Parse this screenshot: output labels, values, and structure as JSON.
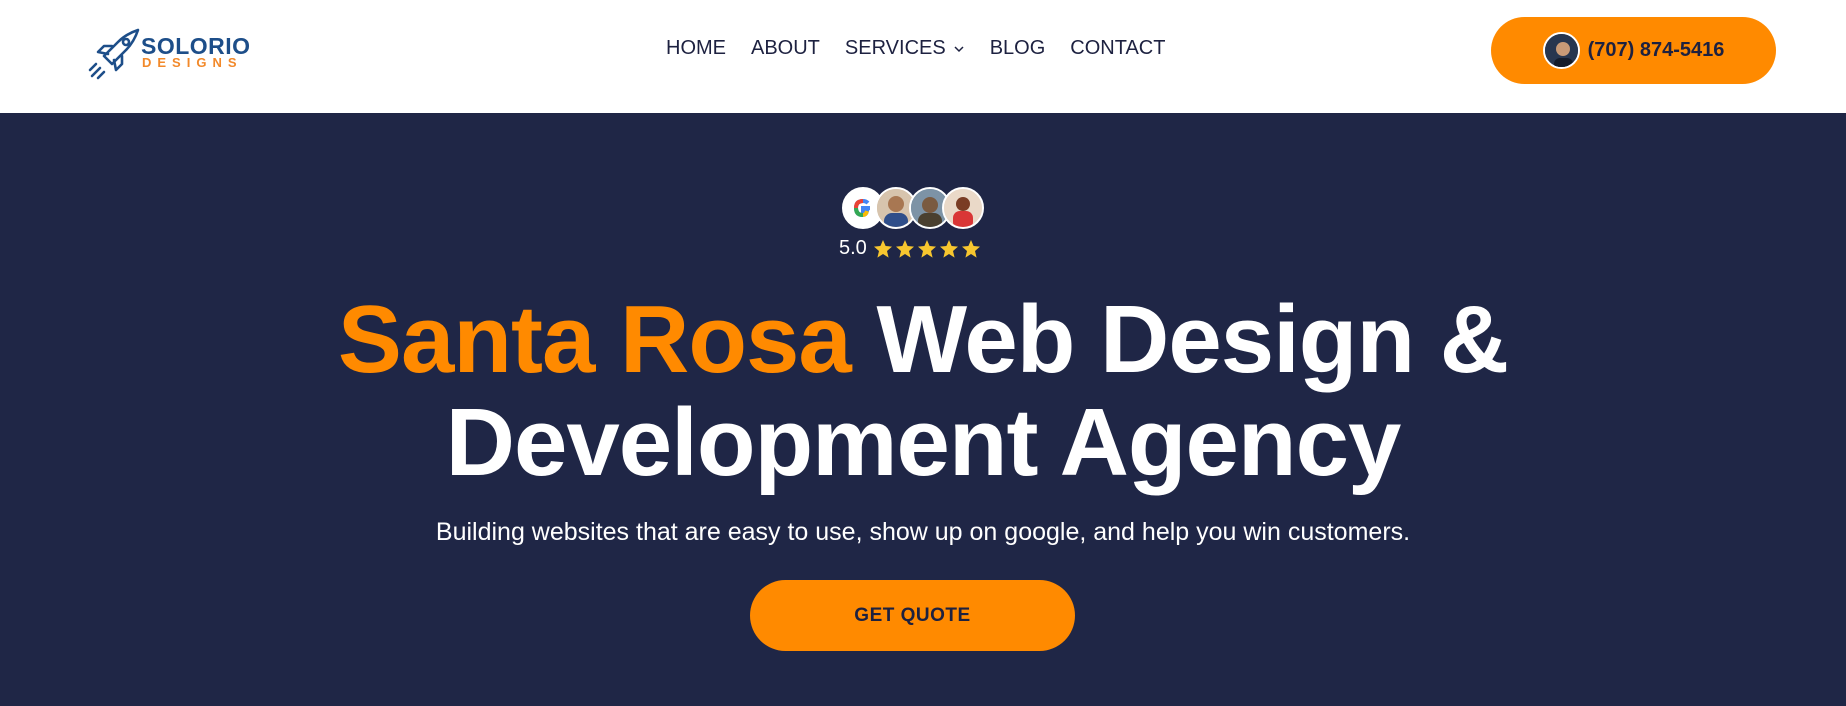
{
  "brand": {
    "name_main": "SOLORIO",
    "name_sub": "DESIGNS",
    "icon": "rocket-icon",
    "colors": {
      "primary": "#1d4e89",
      "accent": "#f2892a"
    }
  },
  "nav": {
    "items": [
      {
        "label": "HOME"
      },
      {
        "label": "ABOUT"
      },
      {
        "label": "SERVICES",
        "has_dropdown": true
      },
      {
        "label": "BLOG"
      },
      {
        "label": "CONTACT"
      }
    ]
  },
  "header": {
    "phone_label": "(707) 874-5416",
    "phone_bg": "#ff8a00"
  },
  "hero": {
    "background": "#1f2646",
    "rating": {
      "score": "5.0",
      "stars": 5,
      "star_color": "#f7c62f"
    },
    "avatars": [
      "google-icon",
      "reviewer-avatar",
      "reviewer-avatar",
      "reviewer-avatar"
    ],
    "headline_accent": "Santa Rosa",
    "headline_rest_line1": "Web Design &",
    "headline_line2": "Development Agency",
    "subheadline": "Building websites that are easy to use, show up on google, and help you win customers.",
    "cta_label": "GET QUOTE",
    "accent_color": "#ff8a00"
  }
}
